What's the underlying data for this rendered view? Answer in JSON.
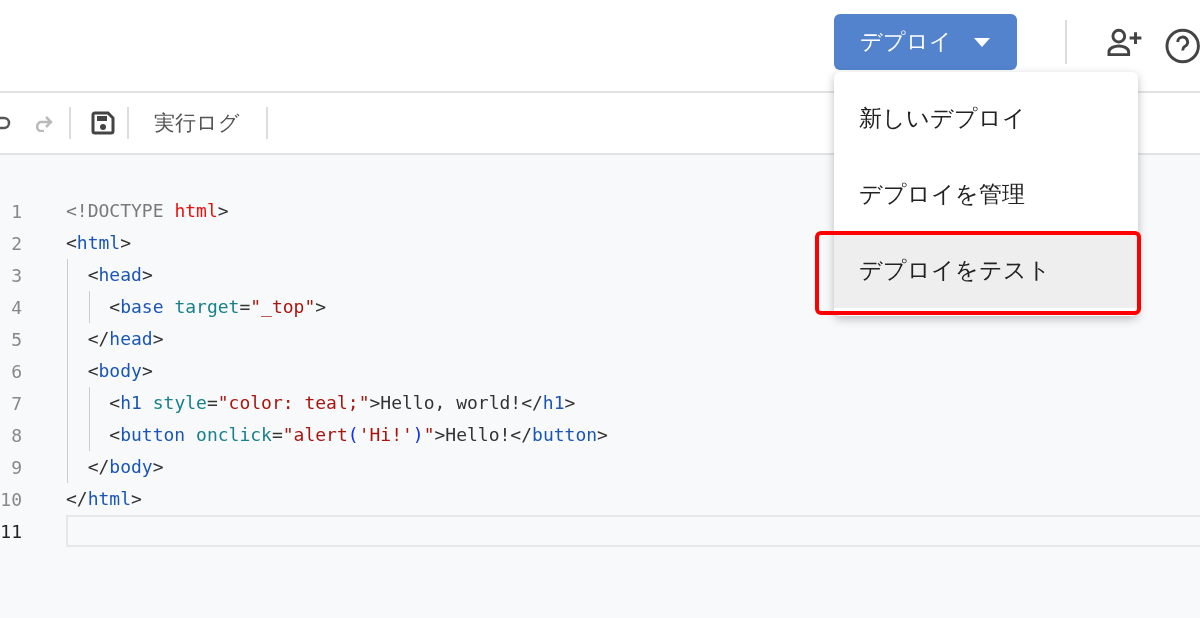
{
  "header": {
    "deploy_button": {
      "label": "デプロイ"
    }
  },
  "deploy_menu": {
    "items": [
      {
        "label": "新しいデプロイ",
        "selected": false,
        "outlined": false
      },
      {
        "label": "デプロイを管理",
        "selected": false,
        "outlined": false
      },
      {
        "label": "デプロイをテスト",
        "selected": true,
        "outlined": true
      }
    ]
  },
  "toolbar": {
    "log_button": {
      "label": "実行ログ"
    }
  },
  "editor": {
    "lines": [
      {
        "number": "1",
        "current": false,
        "tokens": [
          {
            "kind": "doc",
            "text": "<!DOCTYPE "
          },
          {
            "kind": "key",
            "text": "html"
          },
          {
            "kind": "punct",
            "text": ">"
          }
        ]
      },
      {
        "number": "2",
        "current": false,
        "tokens": [
          {
            "kind": "punct",
            "text": "<"
          },
          {
            "kind": "tag",
            "text": "html"
          },
          {
            "kind": "punct",
            "text": ">"
          }
        ]
      },
      {
        "number": "3",
        "current": false,
        "tokens": [
          {
            "kind": "punct",
            "text": "  <"
          },
          {
            "kind": "tag",
            "text": "head"
          },
          {
            "kind": "punct",
            "text": ">"
          }
        ]
      },
      {
        "number": "4",
        "current": false,
        "tokens": [
          {
            "kind": "punct",
            "text": "    <"
          },
          {
            "kind": "tag",
            "text": "base"
          },
          {
            "kind": "attr",
            "text": " target"
          },
          {
            "kind": "punct",
            "text": "="
          },
          {
            "kind": "string",
            "text": "\"_top\""
          },
          {
            "kind": "punct",
            "text": ">"
          }
        ]
      },
      {
        "number": "5",
        "current": false,
        "tokens": [
          {
            "kind": "punct",
            "text": "  </"
          },
          {
            "kind": "tag",
            "text": "head"
          },
          {
            "kind": "punct",
            "text": ">"
          }
        ]
      },
      {
        "number": "6",
        "current": false,
        "tokens": [
          {
            "kind": "punct",
            "text": "  <"
          },
          {
            "kind": "tag",
            "text": "body"
          },
          {
            "kind": "punct",
            "text": ">"
          }
        ]
      },
      {
        "number": "7",
        "current": false,
        "tokens": [
          {
            "kind": "punct",
            "text": "    <"
          },
          {
            "kind": "tag",
            "text": "h1"
          },
          {
            "kind": "attr",
            "text": " style"
          },
          {
            "kind": "punct",
            "text": "="
          },
          {
            "kind": "string",
            "text": "\"color: teal;\""
          },
          {
            "kind": "punct",
            "text": ">Hello, world!</"
          },
          {
            "kind": "tag",
            "text": "h1"
          },
          {
            "kind": "punct",
            "text": ">"
          }
        ]
      },
      {
        "number": "8",
        "current": false,
        "tokens": [
          {
            "kind": "punct",
            "text": "    <"
          },
          {
            "kind": "tag",
            "text": "button"
          },
          {
            "kind": "attr",
            "text": " onclick"
          },
          {
            "kind": "punct",
            "text": "="
          },
          {
            "kind": "string",
            "text": "\"alert"
          },
          {
            "kind": "paren",
            "text": "("
          },
          {
            "kind": "string",
            "text": "'Hi!'"
          },
          {
            "kind": "paren",
            "text": ")"
          },
          {
            "kind": "string",
            "text": "\""
          },
          {
            "kind": "punct",
            "text": ">Hello!</"
          },
          {
            "kind": "tag",
            "text": "button"
          },
          {
            "kind": "punct",
            "text": ">"
          }
        ]
      },
      {
        "number": "9",
        "current": false,
        "tokens": [
          {
            "kind": "punct",
            "text": "  </"
          },
          {
            "kind": "tag",
            "text": "body"
          },
          {
            "kind": "punct",
            "text": ">"
          }
        ]
      },
      {
        "number": "10",
        "current": false,
        "tokens": [
          {
            "kind": "punct",
            "text": "</"
          },
          {
            "kind": "tag",
            "text": "html"
          },
          {
            "kind": "punct",
            "text": ">"
          }
        ]
      },
      {
        "number": "11",
        "current": true
      }
    ]
  }
}
